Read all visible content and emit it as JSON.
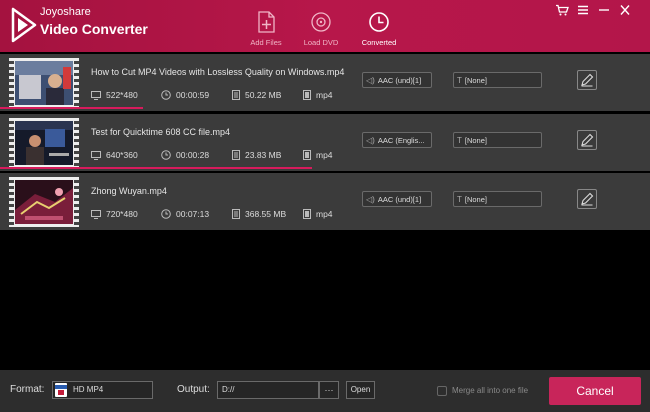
{
  "app": {
    "brand": "Joyoshare",
    "product": "Video Converter"
  },
  "toolbar": {
    "add_files": "Add Files",
    "load_dvd": "Load DVD",
    "converted": "Converted"
  },
  "window_controls": {
    "cart": "cart-icon",
    "menu": "menu-icon",
    "minimize": "minimize-icon",
    "close": "close-icon"
  },
  "files": [
    {
      "name": "How to Cut MP4 Videos with Lossless Quality on Windows.mp4",
      "resolution": "522*480",
      "duration": "00:00:59",
      "size": "50.22 MB",
      "format": "mp4",
      "audio": "AAC (und)[1]",
      "subtitle": "[None]",
      "progress": 0.22
    },
    {
      "name": "Test for Quicktime 608 CC file.mp4",
      "resolution": "640*360",
      "duration": "00:00:28",
      "size": "23.83 MB",
      "format": "mp4",
      "audio": "AAC (Englis...",
      "subtitle": "[None]",
      "progress": 0.48
    },
    {
      "name": "Zhong Wuyan.mp4",
      "resolution": "720*480",
      "duration": "00:07:13",
      "size": "368.55 MB",
      "format": "mp4",
      "audio": "AAC (und)[1]",
      "subtitle": "[None]",
      "progress": 0
    }
  ],
  "bottom": {
    "format_label": "Format:",
    "format_value": "HD MP4",
    "output_label": "Output:",
    "output_value": "D://",
    "browse": "···",
    "open": "Open",
    "merge": "Merge all into one file",
    "cancel": "Cancel"
  },
  "colors": {
    "accent": "#c8255a",
    "header": "#b3164a",
    "progress": "#d61b5c"
  }
}
